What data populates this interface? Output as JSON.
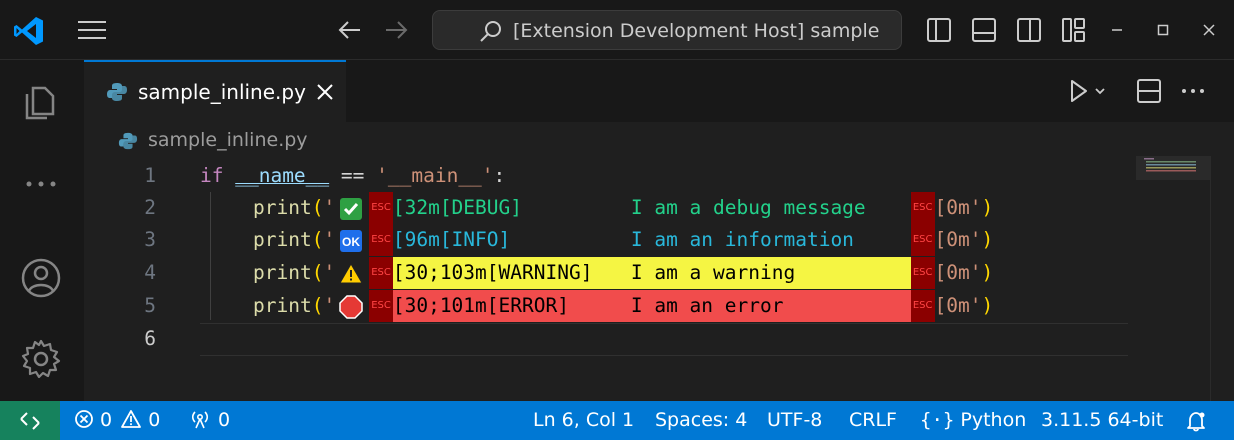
{
  "window": {
    "title": "[Extension Development Host] sample"
  },
  "tab": {
    "label": "sample_inline.py"
  },
  "breadcrumb": {
    "file": "sample_inline.py"
  },
  "code": {
    "line_numbers": [
      "1",
      "2",
      "3",
      "4",
      "5",
      "6"
    ],
    "line1": {
      "kw": "if",
      "id": "__name__",
      "op": "==",
      "str": "'__main__'",
      "colon": ":"
    },
    "line2": {
      "fn": "print",
      "open": "(",
      "q": "'",
      "code": "[32m[DEBUG]",
      "msg": "I am a debug message",
      "reset": "[0m'",
      "close": ")"
    },
    "line3": {
      "fn": "print",
      "open": "(",
      "q": "'",
      "code": "[96m[INFO]",
      "msg": "I am an information",
      "reset": "[0m'",
      "close": ")"
    },
    "line4": {
      "fn": "print",
      "open": "(",
      "q": "'",
      "code": "[30;103m[WARNING]",
      "msg": "I am a warning",
      "reset": "[0m'",
      "close": ")"
    },
    "line5": {
      "fn": "print",
      "open": "(",
      "q": "'",
      "code": "[30;101m[ERROR]",
      "msg": "I am an error",
      "reset": "[0m'",
      "close": ")"
    },
    "esc_label": "ESC",
    "colors": {
      "debug": "#23d18b",
      "info": "#29b8db",
      "warning_bg": "#f5f543",
      "error_bg": "#f14c4c"
    }
  },
  "statusbar": {
    "errors": "0",
    "warnings": "0",
    "ports": "0",
    "position": "Ln 6, Col 1",
    "spaces": "Spaces: 4",
    "encoding": "UTF-8",
    "eol": "CRLF",
    "language": "Python",
    "interpreter": "3.11.5 64-bit"
  },
  "icons": {
    "app": "vscode-icon",
    "menu": "hamburger-icon",
    "back": "arrow-left-icon",
    "forward": "arrow-right-icon",
    "search": "search-icon",
    "explorer": "files-icon",
    "more": "ellipsis-icon",
    "account": "account-icon",
    "settings": "gear-icon"
  }
}
